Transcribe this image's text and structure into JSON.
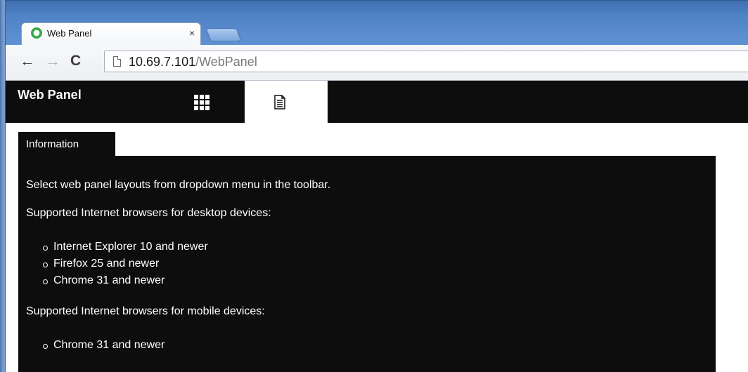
{
  "browser": {
    "tab_title": "Web Panel",
    "tab_close": "×",
    "url_host": "10.69.7.101",
    "url_path": "/WebPanel",
    "nav": {
      "back": "←",
      "forward": "→",
      "reload": "C"
    }
  },
  "app": {
    "title": "Web Panel",
    "icons": [
      "grid-icon",
      "document-icon"
    ]
  },
  "panel": {
    "tab_label": "Information",
    "intro": "Select web panel layouts from dropdown menu in the toolbar.",
    "desktop_heading": "Supported Internet browsers for desktop devices:",
    "desktop_browsers": [
      "Internet Explorer 10 and newer",
      "Firefox 25 and newer",
      "Chrome 31 and newer"
    ],
    "mobile_heading": "Supported Internet browsers for mobile devices:",
    "mobile_browsers": [
      "Chrome 31 and newer"
    ]
  },
  "colors": {
    "header_bg": "#0d0d0d",
    "panel_bg": "#0d0d0d",
    "text_on_dark": "#ffffff",
    "tabstrip_blue": "#4f82c6"
  }
}
